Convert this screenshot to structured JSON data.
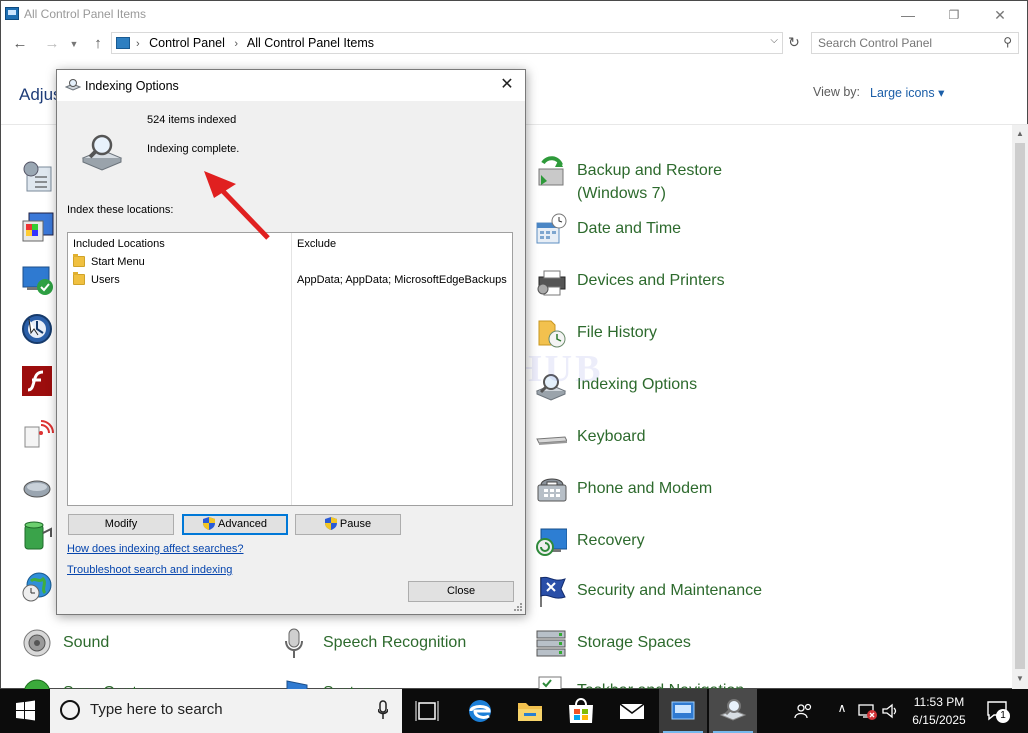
{
  "window": {
    "title": "All Control Panel Items",
    "minimize_glyph": "—",
    "maximize_glyph": "❐",
    "close_glyph": "✕"
  },
  "address_bar": {
    "crumb_1": "Control Panel",
    "crumb_2": "All Control Panel Items",
    "separator": "›",
    "search_placeholder": "Search Control Panel"
  },
  "header": {
    "heading": "Adjus",
    "view_by_label": "View by:",
    "view_by_value": "Large icons ▾"
  },
  "items_col3": [
    {
      "label_line1": "Backup and Restore",
      "label_line2": "(Windows 7)",
      "icon": "backup-restore-icon"
    },
    {
      "label": "Date and Time",
      "icon": "date-time-icon"
    },
    {
      "label": "Devices and Printers",
      "icon": "devices-printers-icon"
    },
    {
      "label": "File History",
      "icon": "file-history-icon"
    },
    {
      "label": "Indexing Options",
      "icon": "indexing-options-icon"
    },
    {
      "label": "Keyboard",
      "icon": "keyboard-icon"
    },
    {
      "label": "Phone and Modem",
      "icon": "phone-modem-icon"
    },
    {
      "label": "Recovery",
      "icon": "recovery-icon"
    },
    {
      "label": "Security and Maintenance",
      "icon": "security-maintenance-icon"
    },
    {
      "label": "Storage Spaces",
      "icon": "storage-spaces-icon"
    },
    {
      "label": "Taskbar and Navigation",
      "icon": "taskbar-navigation-icon"
    }
  ],
  "items_row_bottom": [
    {
      "label": "Sound",
      "icon": "sound-icon"
    },
    {
      "label": "Speech Recognition",
      "icon": "speech-recognition-icon"
    },
    {
      "label": "Sync Center",
      "icon": "sync-center-icon"
    },
    {
      "label": "System",
      "icon": "system-icon"
    }
  ],
  "watermark": "IT ProsHUB",
  "dialog": {
    "title": "Indexing Options",
    "close_glyph": "✕",
    "items_indexed": "524 items indexed",
    "status": "Indexing complete.",
    "index_label": "Index these locations:",
    "col_included": "Included Locations",
    "col_exclude": "Exclude",
    "locations": [
      {
        "name": "Start Menu",
        "exclude": ""
      },
      {
        "name": "Users",
        "exclude": "AppData; AppData; MicrosoftEdgeBackups"
      }
    ],
    "btn_modify": "Modify",
    "btn_advanced": "Advanced",
    "btn_pause": "Pause",
    "link_1": "How does indexing affect searches?",
    "link_2": "Troubleshoot search and indexing",
    "btn_close": "Close"
  },
  "taskbar": {
    "search_text": "Type here to search",
    "time": "11:53 PM",
    "date": "6/15/2025",
    "notification_count": "1"
  },
  "colors": {
    "accent": "#0078d7",
    "link": "#0645ad",
    "item_label": "#2d6a2d",
    "arrow": "#e02020"
  }
}
